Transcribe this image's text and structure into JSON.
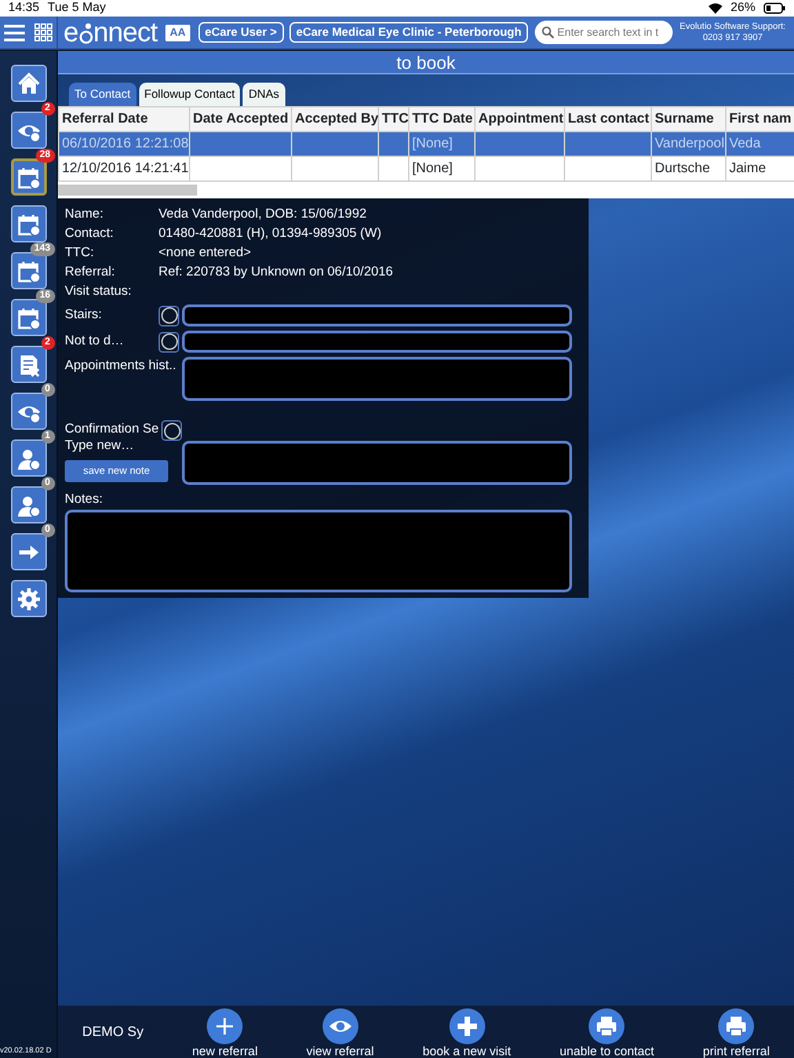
{
  "status_bar": {
    "time": "14:35",
    "date": "Tue 5 May",
    "battery": "26%"
  },
  "header": {
    "logo_start": "e",
    "logo_end": "nnect",
    "font_button": "AA",
    "user_button": "eCare User  >",
    "clinic_button": "eCare Medical Eye Clinic - Peterborough",
    "search": {
      "placeholder": "Enter search text in t"
    },
    "support": [
      "Evolutio Software Support:",
      "0203 917 3907"
    ]
  },
  "sidebar": [
    {
      "kind": "home",
      "selected": false
    },
    {
      "kind": "eye",
      "badge": "2",
      "color": "#e02424",
      "selected": false
    },
    {
      "kind": "calendar",
      "badge": "28",
      "color": "#e02424",
      "selected": true
    },
    {
      "kind": "calendar",
      "selected": false
    },
    {
      "kind": "calendar",
      "badge": "143",
      "color": "#8c8c8c",
      "selected": false
    },
    {
      "kind": "calendar",
      "badge": "16",
      "color": "#8c8c8c",
      "selected": false
    },
    {
      "kind": "document",
      "badge": "2",
      "color": "#e02424",
      "selected": false
    },
    {
      "kind": "eye",
      "badge": "0",
      "color": "#8c8c8c",
      "selected": false
    },
    {
      "kind": "person",
      "badge": "1",
      "color": "#8c8c8c",
      "selected": false
    },
    {
      "kind": "person",
      "badge": "0",
      "color": "#8c8c8c",
      "selected": false
    },
    {
      "kind": "arrow",
      "badge": "0",
      "color": "#8c8c8c",
      "selected": false
    },
    {
      "kind": "gear",
      "selected": false
    }
  ],
  "page_title": "to book",
  "tabs": [
    {
      "label": "To Contact",
      "selected": true
    },
    {
      "label": "Followup Contact",
      "selected": false
    },
    {
      "label": "DNAs",
      "selected": false
    }
  ],
  "table": {
    "columns": [
      "Referral Date",
      "Date Accepted",
      "Accepted By",
      "TTC",
      "TTC Date",
      "Appointment",
      "Last contact",
      "Surname",
      "First nam"
    ],
    "rows": [
      {
        "selected": true,
        "cells": [
          "06/10/2016 12:21:08",
          "",
          "",
          "",
          "[None]",
          "",
          "",
          "Vanderpool",
          "Veda"
        ]
      },
      {
        "selected": false,
        "cells": [
          "12/10/2016 14:21:41",
          "",
          "",
          "",
          "[None]",
          "",
          "",
          "Durtsche",
          "Jaime"
        ]
      }
    ]
  },
  "details": {
    "info": [
      {
        "label": "Name:",
        "value": "Veda Vanderpool, DOB: 15/06/1992"
      },
      {
        "label": "Contact:",
        "value": "01480-420881 (H), 01394-989305 (W)"
      },
      {
        "label": "TTC:",
        "value": "<none entered>"
      },
      {
        "label": "Referral:",
        "value": "Ref: 220783 by Unknown on 06/10/2016"
      },
      {
        "label": "Visit status:"
      }
    ],
    "stairs": {
      "label": "Stairs:",
      "checked": false
    },
    "not_to_disturb": {
      "label": "Not to d…",
      "checked": false
    },
    "appointments_history": {
      "label": "Appointments hist.."
    },
    "confirmation": {
      "label": "Confirmation Se",
      "checked": false
    },
    "new_note": {
      "label": "Type new…",
      "button": "save new note"
    },
    "notes": {
      "label": "Notes:"
    }
  },
  "footer": {
    "system": "DEMO Sy",
    "version": "v20.02.18.02 D",
    "actions": [
      {
        "kind": "plus",
        "label": "new referral"
      },
      {
        "kind": "eye",
        "label": "view referral"
      },
      {
        "kind": "cross",
        "label": "book a new visit"
      },
      {
        "kind": "printer",
        "label": "unable to contact"
      },
      {
        "kind": "printer",
        "label": "print referral"
      }
    ]
  }
}
